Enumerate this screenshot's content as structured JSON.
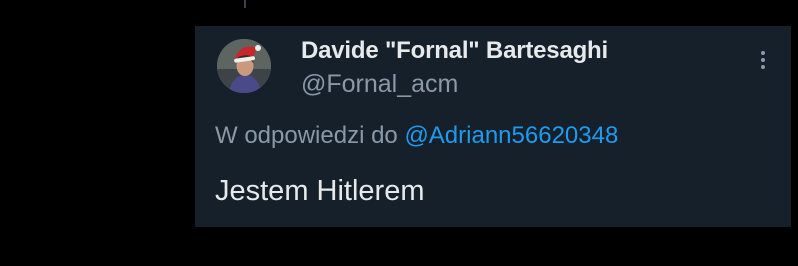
{
  "tweet": {
    "display_name": "Davide \"Fornal\" Bartesaghi",
    "handle": "@Fornal_acm",
    "reply_prefix": "W odpowiedzi do",
    "reply_to": "@Adriann56620348",
    "text": "Jestem Hitlerem",
    "more_icon": "more-vertical-icon",
    "avatar": "profile-avatar-santa-hat"
  },
  "colors": {
    "page_background": "#000000",
    "card_background": "#15202b",
    "primary_text": "#e7e9ea",
    "secondary_text": "#8b98a5",
    "link": "#1d9bf0"
  }
}
